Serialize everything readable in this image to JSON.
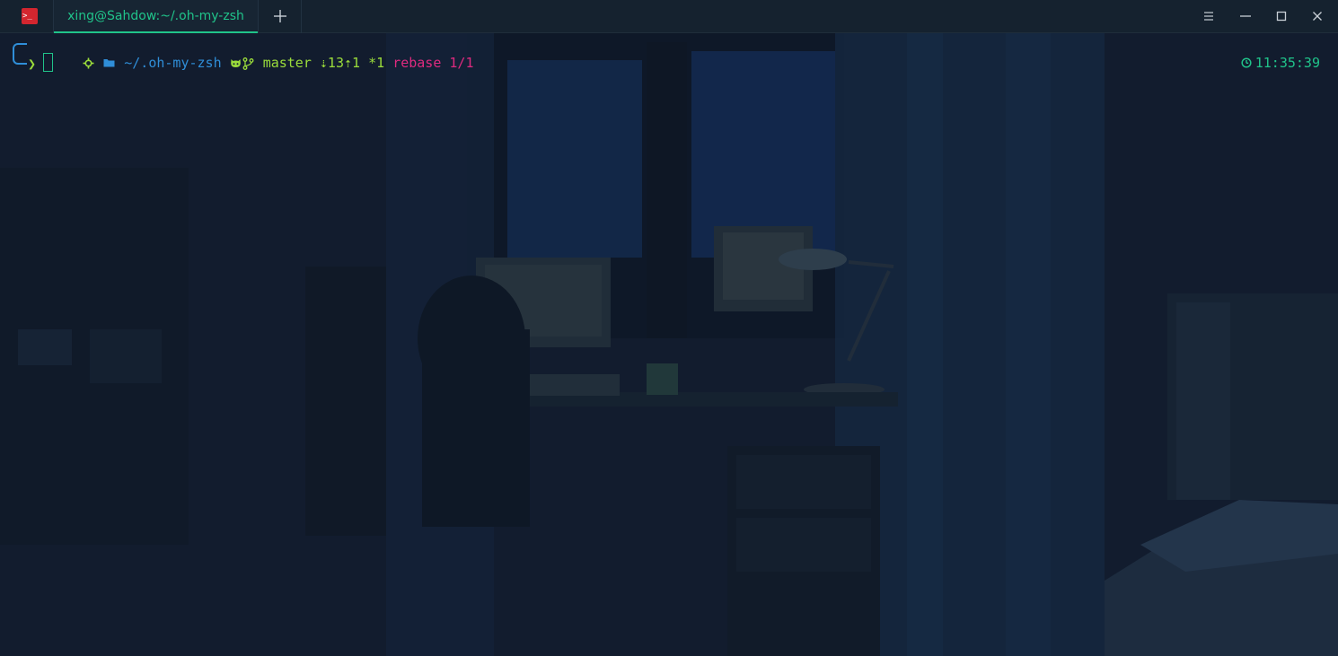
{
  "titlebar": {
    "app_icon_glyph": ">_",
    "tab_title": "xing@Sahdow:~/.oh-my-zsh",
    "new_tab_icon": "plus-icon",
    "menu_icon": "hamburger-menu-icon",
    "minimize_icon": "minimize-icon",
    "maximize_icon": "maximize-icon",
    "close_icon": "close-icon"
  },
  "prompt": {
    "os_icon": "gear-icon",
    "folder_icon": "folder-icon",
    "path": "~/.oh-my-zsh",
    "vcs_icon": "github-cat-icon",
    "branch_icon": "git-branch-icon",
    "branch": "master",
    "behind_ahead": "⇣13⇡1",
    "changes": "*1",
    "state": "rebase 1/1",
    "prompt_char": "❯",
    "clock_icon": "clock-icon",
    "time": "11:35:39"
  },
  "colors": {
    "accent_green": "#9bdc3b",
    "path_blue": "#2f8ed8",
    "rebase_pink": "#de2a7f",
    "teal": "#20c38a"
  }
}
